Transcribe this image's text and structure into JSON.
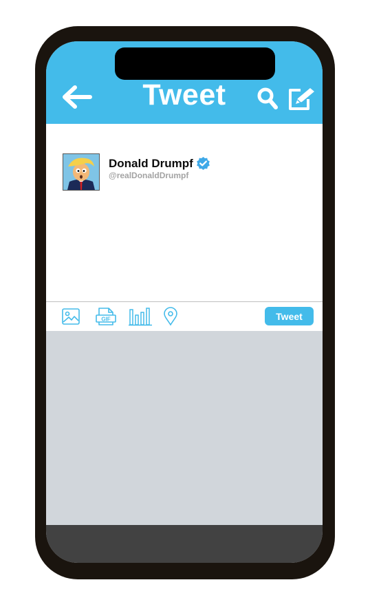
{
  "header": {
    "title": "Tweet",
    "back_icon": "arrow-left-icon",
    "search_icon": "search-icon",
    "compose_icon": "compose-icon"
  },
  "tweet": {
    "display_name": "Donald Drumpf",
    "handle": "@realDonaldDrumpf",
    "verified": true,
    "text": ""
  },
  "toolbar": {
    "icons": [
      "image-icon",
      "gif-icon",
      "poll-icon",
      "location-icon"
    ],
    "gif_label": "GIF",
    "tweet_button_label": "Tweet"
  },
  "colors": {
    "accent": "#43bbea",
    "phone_frame": "#1a140e",
    "screen_background": "#d1d6db",
    "bottom_bar": "#424242",
    "handle_text": "#a3a3a3"
  }
}
